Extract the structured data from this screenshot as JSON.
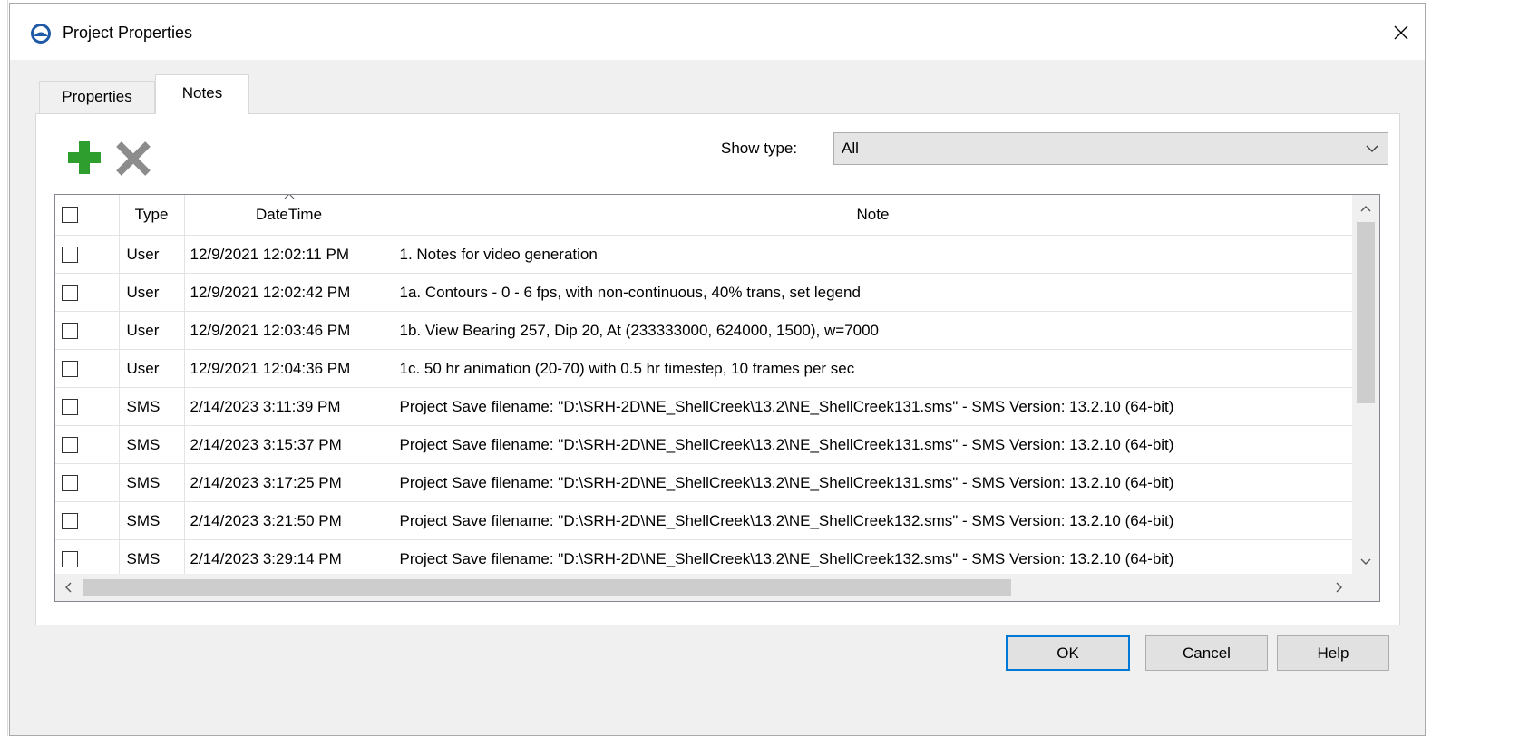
{
  "window": {
    "title": "Project Properties"
  },
  "tabs": [
    {
      "label": "Properties",
      "active": false
    },
    {
      "label": "Notes",
      "active": true
    }
  ],
  "toolbar": {
    "add_icon": "plus-icon",
    "delete_icon": "x-delete-icon",
    "add_color": "#2e9e2e",
    "delete_color": "#8c8c8c"
  },
  "filter": {
    "label": "Show type:",
    "value": "All"
  },
  "table": {
    "columns": [
      "",
      "Type",
      "DateTime",
      "Note"
    ],
    "rows": [
      {
        "type": "User",
        "datetime": "12/9/2021 12:02:11 PM",
        "note": "1. Notes for video generation"
      },
      {
        "type": "User",
        "datetime": "12/9/2021 12:02:42 PM",
        "note": "1a. Contours - 0 - 6 fps, with non-continuous, 40% trans, set legend"
      },
      {
        "type": "User",
        "datetime": "12/9/2021 12:03:46 PM",
        "note": "1b. View Bearing 257, Dip 20, At (233333000, 624000, 1500), w=7000"
      },
      {
        "type": "User",
        "datetime": "12/9/2021 12:04:36 PM",
        "note": "1c. 50 hr animation (20-70) with 0.5 hr timestep, 10 frames per sec"
      },
      {
        "type": "SMS",
        "datetime": "2/14/2023 3:11:39 PM",
        "note": "Project Save filename: \"D:\\SRH-2D\\NE_ShellCreek\\13.2\\NE_ShellCreek131.sms\" - SMS Version: 13.2.10 (64-bit)"
      },
      {
        "type": "SMS",
        "datetime": "2/14/2023 3:15:37 PM",
        "note": "Project Save filename: \"D:\\SRH-2D\\NE_ShellCreek\\13.2\\NE_ShellCreek131.sms\" - SMS Version: 13.2.10 (64-bit)"
      },
      {
        "type": "SMS",
        "datetime": "2/14/2023 3:17:25 PM",
        "note": "Project Save filename: \"D:\\SRH-2D\\NE_ShellCreek\\13.2\\NE_ShellCreek131.sms\" - SMS Version: 13.2.10 (64-bit)"
      },
      {
        "type": "SMS",
        "datetime": "2/14/2023 3:21:50 PM",
        "note": "Project Save filename: \"D:\\SRH-2D\\NE_ShellCreek\\13.2\\NE_ShellCreek132.sms\" - SMS Version: 13.2.10 (64-bit)"
      },
      {
        "type": "SMS",
        "datetime": "2/14/2023 3:29:14 PM",
        "note": "Project Save filename: \"D:\\SRH-2D\\NE_ShellCreek\\13.2\\NE_ShellCreek132.sms\" - SMS Version: 13.2.10 (64-bit)"
      }
    ]
  },
  "buttons": {
    "ok": "OK",
    "cancel": "Cancel",
    "help": "Help"
  }
}
